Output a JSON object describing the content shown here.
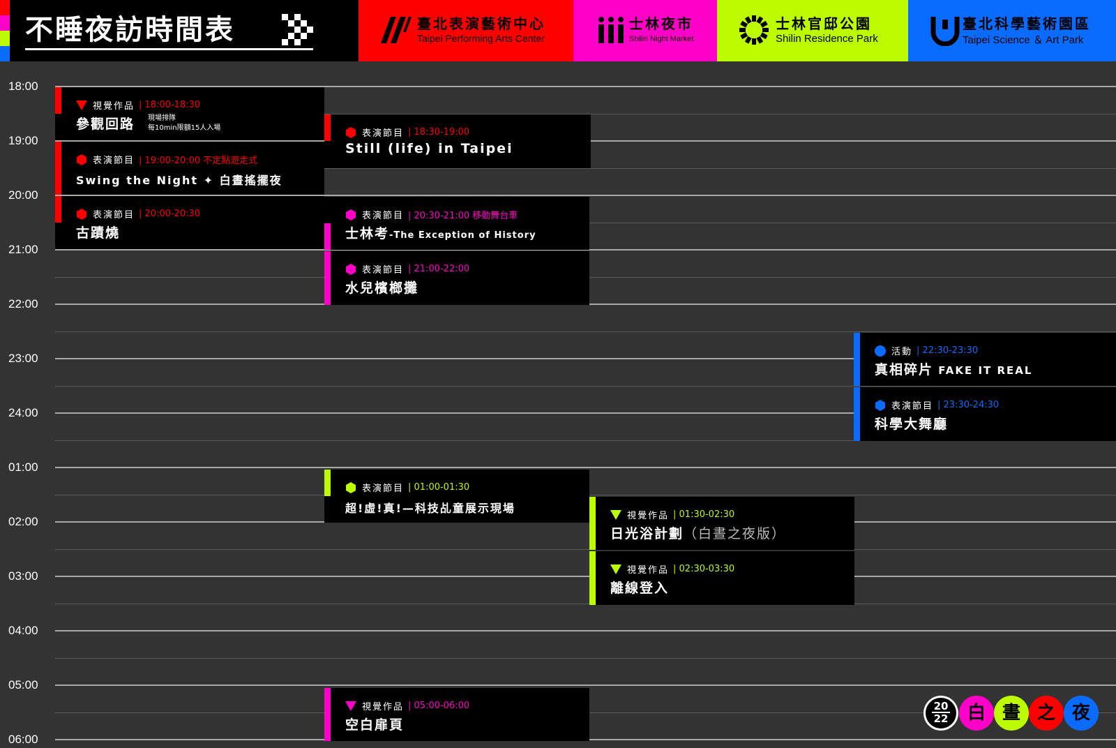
{
  "title": "不睡夜訪時間表",
  "venues": [
    {
      "name": "臺北表演藝術中心",
      "en": "Taipei Performing Arts Center",
      "color": "#ff0000",
      "icon": "slash-lines-icon"
    },
    {
      "name": "士林夜市",
      "en": "Shilin Night Market",
      "color": "#ff00c8",
      "icon": "iii-icon"
    },
    {
      "name": "士林官邸公園",
      "en": "Shilin Residence Park",
      "color": "#bdfc00",
      "icon": "sunburst-icon"
    },
    {
      "name": "臺北科學藝術園區",
      "en": "Taipei Science ＆ Art Park",
      "color": "#0a6cff",
      "icon": "u-magnet-icon"
    }
  ],
  "colors": {
    "red": "#ff0000",
    "magenta": "#ff00c8",
    "lime": "#bdfc00",
    "blue": "#0a6cff",
    "background": "#333333"
  },
  "times": [
    "18:00",
    "19:00",
    "20:00",
    "21:00",
    "22:00",
    "23:00",
    "24:00",
    "01:00",
    "02:00",
    "03:00",
    "04:00",
    "05:00",
    "06:00"
  ],
  "events": {
    "e1": {
      "category": "視覺作品",
      "time": "| 18:00-18:30",
      "title": "參觀回路",
      "note1": "現場排隊",
      "note2": "每10min限額15人入場"
    },
    "e2": {
      "category": "表演節目",
      "time": "| 18:30-19:00",
      "title": "Still (life) in Taipei"
    },
    "e3": {
      "category": "表演節目",
      "time": "| 19:00-20:00 不定點遊走式",
      "title": "Swing the Night ✦ 白晝搖擺夜"
    },
    "e4": {
      "category": "表演節目",
      "time": "| 20:00-20:30",
      "title": "古蹟燒"
    },
    "e5": {
      "category": "表演節目",
      "time": "| 20:30-21:00 移動舞台車",
      "title": "士林考",
      "subtitle": "-The Exception of History"
    },
    "e6": {
      "category": "表演節目",
      "time": "| 21:00-22:00",
      "title": "水兒檳榔攤"
    },
    "e7": {
      "category": "活動",
      "time": "| 22:30-23:30",
      "title": "真相碎片",
      "subtitle": " FAKE IT REAL"
    },
    "e8": {
      "category": "表演節目",
      "time": "| 23:30-24:30",
      "title": "科學大舞廳"
    },
    "e9": {
      "category": "表演節目",
      "time": "| 01:00-01:30",
      "title": "超!虛!真!—科技乩童展示現場"
    },
    "e10": {
      "category": "視覺作品",
      "time": "| 01:30-02:30",
      "title": "日光浴計劃",
      "paren": "（白晝之夜版）"
    },
    "e11": {
      "category": "視覺作品",
      "time": "| 02:30-03:30",
      "title": "離線登入"
    },
    "e12": {
      "category": "視覺作品",
      "time": "| 05:00-06:00",
      "title": "空白扉頁"
    }
  },
  "logo": {
    "year_top": "20",
    "year_bottom": "22",
    "chars": [
      "白",
      "晝",
      "之",
      "夜"
    ]
  }
}
